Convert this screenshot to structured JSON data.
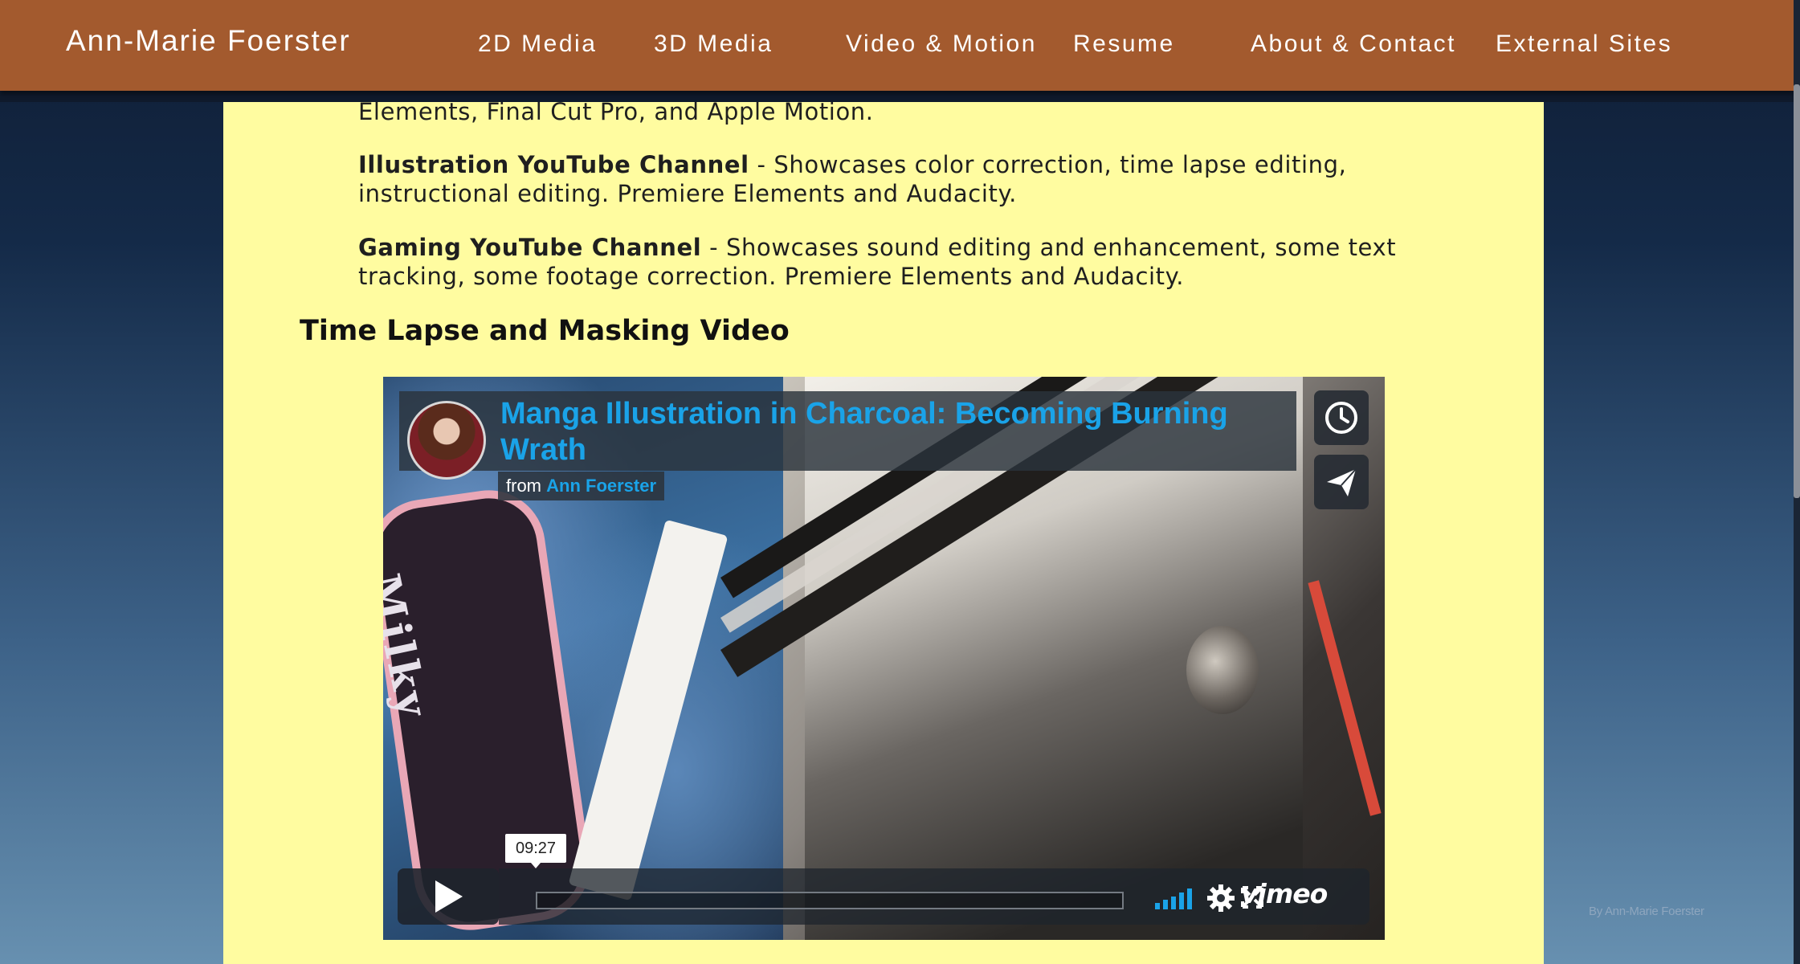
{
  "site": {
    "brand": "Ann-Marie Foerster",
    "nav": [
      {
        "label": "2D Media"
      },
      {
        "label": "3D Media"
      },
      {
        "label": "Video & Motion"
      },
      {
        "label": "Resume"
      },
      {
        "label": "About & Contact"
      },
      {
        "label": "External Sites"
      }
    ]
  },
  "content": {
    "intro_tail": "Elements, Final Cut Pro, and Apple Motion.",
    "items": [
      {
        "title": "Illustration YouTube Channel",
        "desc_line1": " - Showcases color correction, time lapse editing,",
        "desc_line2": "instructional editing. Premiere Elements and Audacity."
      },
      {
        "title": "Gaming YouTube Channel",
        "desc_line1": " - Showcases sound editing and enhancement, some text",
        "desc_line2": "tracking, some footage correction. Premiere Elements and Audacity."
      }
    ],
    "section_title": "Time Lapse and Masking Video"
  },
  "video": {
    "title": "Manga Illustration in Charcoal: Becoming Burning Wrath",
    "from_label": "from",
    "author": "Ann Foerster",
    "duration": "09:27",
    "player_brand": "vimeo",
    "tin_text": "Milky",
    "icons": [
      "clock-icon",
      "paper-plane-icon",
      "play-icon",
      "volume-bars-icon",
      "gear-icon",
      "fullscreen-icon"
    ],
    "accent_color": "#1aa3e8"
  },
  "footer": {
    "credit": "By Ann-Marie Foerster"
  },
  "colors": {
    "header_bg": "#a35a2e",
    "panel_bg": "#fffca0",
    "page_bg_top": "#0f1d34",
    "page_bg_bottom": "#6790b0"
  }
}
